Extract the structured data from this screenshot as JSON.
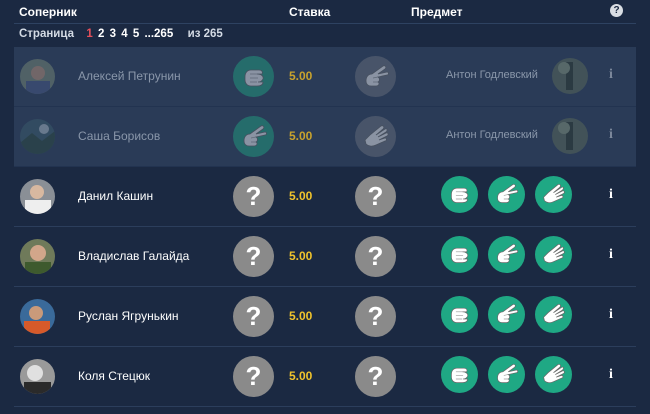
{
  "header": {
    "col_opponent": "Соперник",
    "col_bet": "Ставка",
    "col_item": "Предмет",
    "help_icon": "?"
  },
  "pager": {
    "label": "Страница",
    "pages": [
      "1",
      "2",
      "3",
      "4",
      "5"
    ],
    "active": "1",
    "ellipsis_last": "...265",
    "of_label": "из",
    "total": "265"
  },
  "rows": [
    {
      "name": "Алексей Петрунин",
      "bet": "5.00",
      "opponent": "Антон Годлевский",
      "state": "waiting",
      "info": "i"
    },
    {
      "name": "Саша Борисов",
      "bet": "5.00",
      "opponent": "Антон Годлевский",
      "state": "waiting",
      "info": "i"
    },
    {
      "name": "Данил Кашин",
      "bet": "5.00",
      "state": "open",
      "q": "?",
      "info": "i"
    },
    {
      "name": "Владислав Галайда",
      "bet": "5.00",
      "state": "open",
      "q": "?",
      "info": "i"
    },
    {
      "name": "Руслан Ягрунькин",
      "bet": "5.00",
      "state": "open",
      "q": "?",
      "info": "i"
    },
    {
      "name": "Коля Стецюк",
      "bet": "5.00",
      "state": "open",
      "q": "?",
      "info": "i"
    }
  ],
  "choices": [
    "rock",
    "scissors",
    "paper"
  ],
  "colors": {
    "background": "#1b2942",
    "accent_green": "#1fa884",
    "bet_yellow": "#f0c32c",
    "active_page": "#e8505b"
  },
  "icons": {
    "help": "question-circle-icon",
    "info": "info-icon",
    "hand_rock": "hand-rock-icon",
    "hand_scissors": "hand-scissors-icon",
    "hand_paper": "hand-paper-icon"
  }
}
